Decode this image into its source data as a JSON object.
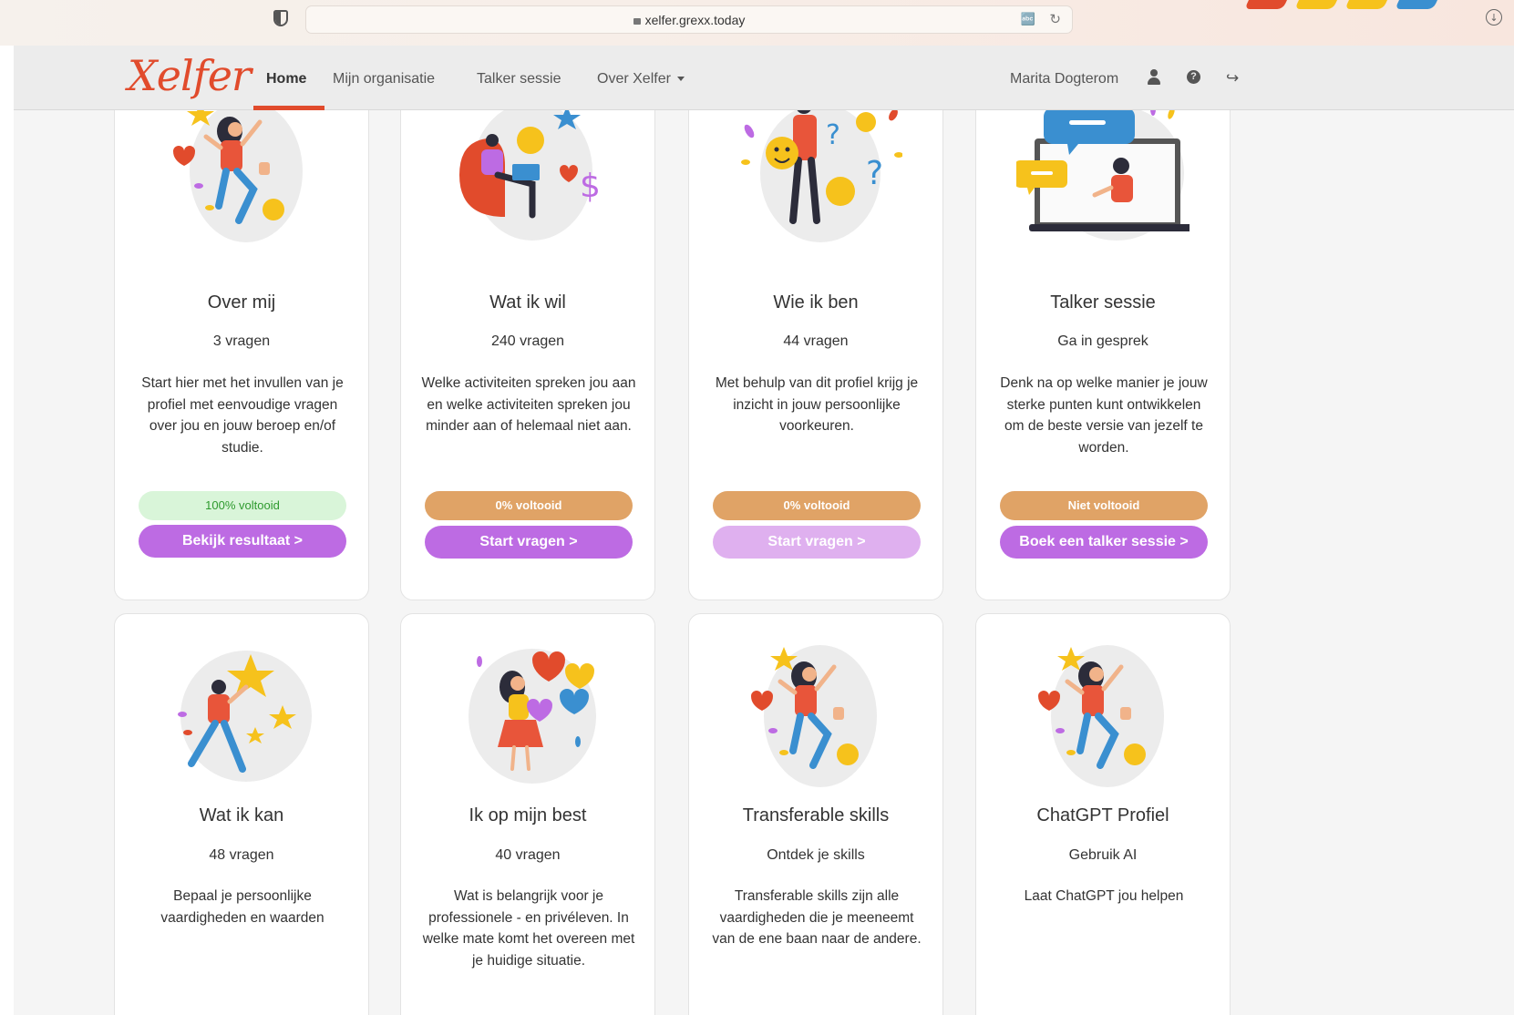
{
  "browser": {
    "url": "xelfer.grexx.today"
  },
  "brand": {
    "logo_text": "Xelfer",
    "accent": "#e14b2c",
    "purple": "#bd6be3",
    "orange": "#e0a366"
  },
  "nav": {
    "home": "Home",
    "org": "Mijn organisatie",
    "talker": "Talker sessie",
    "about": "Over Xelfer",
    "user": "Marita Dogterom"
  },
  "cards": [
    {
      "title": "Over mij",
      "count": "3 vragen",
      "description": "Start hier met het invullen van je profiel met eenvoudige vragen over jou en jouw beroep en/of studie.",
      "status": "100% voltooid",
      "action": "Bekijk resultaat >",
      "progress": 1.0
    },
    {
      "title": "Wat ik wil",
      "count": "240 vragen",
      "description": "Welke activiteiten spreken jou aan en welke activiteiten spreken jou minder aan of helemaal niet aan.",
      "status": "0% voltooid",
      "action": "Start vragen >",
      "progress": 0
    },
    {
      "title": "Wie ik ben",
      "count": "44 vragen",
      "description": "Met behulp van dit profiel krijg je inzicht in jouw persoonlijke voorkeuren.",
      "status": "0% voltooid",
      "action": "Start vragen >",
      "progress": 0
    },
    {
      "title": "Talker sessie",
      "count": "Ga in gesprek",
      "description": "Denk na op welke manier je jouw sterke punten kunt ontwikkelen om de beste versie van jezelf te worden.",
      "status": "Niet voltooid",
      "action": "Boek een talker sessie >"
    },
    {
      "title": "Wat ik kan",
      "count": "48 vragen",
      "description": "Bepaal je persoonlijke vaardigheden en waarden"
    },
    {
      "title": "Ik op mijn best",
      "count": "40 vragen",
      "description": "Wat is belangrijk voor je professionele - en privéleven. In welke mate komt het overeen met je huidige situatie."
    },
    {
      "title": "Transferable skills",
      "count": "Ontdek je skills",
      "description": "Transferable skills zijn alle vaardigheden die je meeneemt van de ene baan naar de andere."
    },
    {
      "title": "ChatGPT Profiel",
      "count": "Gebruik AI",
      "description": "Laat ChatGPT jou helpen"
    }
  ]
}
